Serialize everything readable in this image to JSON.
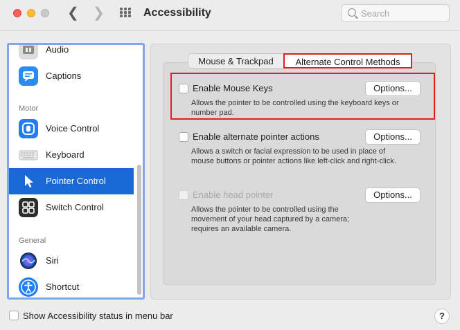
{
  "window": {
    "title": "Accessibility",
    "search_placeholder": "Search"
  },
  "sidebar": {
    "items": [
      {
        "label": "Audio",
        "icon": "audio-icon"
      },
      {
        "label": "Captions",
        "icon": "captions-icon"
      },
      {
        "label": "Voice Control",
        "icon": "voice-control-icon"
      },
      {
        "label": "Keyboard",
        "icon": "keyboard-icon"
      },
      {
        "label": "Pointer Control",
        "icon": "pointer-control-icon",
        "selected": true
      },
      {
        "label": "Switch Control",
        "icon": "switch-control-icon"
      },
      {
        "label": "Siri",
        "icon": "siri-icon"
      },
      {
        "label": "Shortcut",
        "icon": "shortcut-icon"
      }
    ],
    "sections": {
      "motor": "Motor",
      "general": "General"
    }
  },
  "tabs": [
    {
      "label": "Mouse & Trackpad",
      "selected": false
    },
    {
      "label": "Alternate Control Methods",
      "selected": true
    }
  ],
  "options": [
    {
      "label": "Enable Mouse Keys",
      "description": "Allows the pointer to be controlled using the keyboard keys or number pad.",
      "button": "Options...",
      "enabled": true
    },
    {
      "label": "Enable alternate pointer actions",
      "description": "Allows a switch or facial expression to be used in place of mouse buttons or pointer actions like left-click and right-click.",
      "button": "Options...",
      "enabled": true
    },
    {
      "label": "Enable head pointer",
      "description": "Allows the pointer to be controlled using the movement of your head captured by a camera; requires an available camera.",
      "button": "Options...",
      "enabled": false
    }
  ],
  "footer": {
    "status_label": "Show Accessibility status in menu bar",
    "help": "?"
  },
  "colors": {
    "accent": "#1a68d8",
    "highlight": "#e0201c"
  }
}
